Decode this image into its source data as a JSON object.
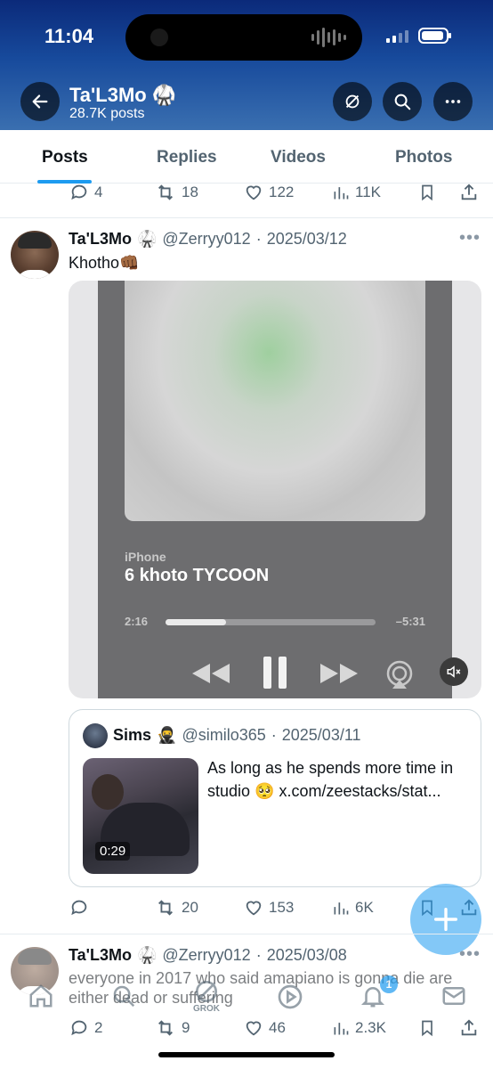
{
  "status_bar": {
    "time": "11:04"
  },
  "header": {
    "profile_name": "Ta'L3Mo 🥋",
    "post_count": "28.7K posts"
  },
  "tabs": [
    {
      "label": "Posts",
      "active": true
    },
    {
      "label": "Replies",
      "active": false
    },
    {
      "label": "Videos",
      "active": false
    },
    {
      "label": "Photos",
      "active": false
    }
  ],
  "prev_post_actions": {
    "replies": "4",
    "reposts": "18",
    "likes": "122",
    "views": "11K"
  },
  "post1": {
    "name": "Ta'L3Mo",
    "emoji": "🥋",
    "handle": "@Zerryy012",
    "date": "2025/03/12",
    "text": "Khotho👊🏾",
    "media": {
      "device": "iPhone",
      "track_title": "6 khoto TYCOON",
      "elapsed": "2:16",
      "remaining": "–5:31",
      "progress": 0.29
    },
    "quote": {
      "name": "Sims",
      "emoji": "🥷",
      "handle": "@similo365",
      "date": "2025/03/11",
      "text": "As long as he spends more time in studio 🥺 x.com/zeestacks/stat...",
      "video_duration": "0:29"
    },
    "actions": {
      "replies": "",
      "reposts": "20",
      "likes": "153",
      "views": "6K"
    }
  },
  "post2": {
    "name": "Ta'L3Mo",
    "emoji": "🥋",
    "handle": "@Zerryy012",
    "date": "2025/03/08",
    "text": "everyone in 2017 who said amapiano is gonna die  are either dead or suffering",
    "actions": {
      "replies": "2",
      "reposts": "9",
      "likes": "46",
      "views": "2.3K"
    }
  },
  "tabbar": {
    "grok_label": "GROK",
    "notification_count": "1"
  },
  "colors": {
    "accent": "#1d9bf0",
    "header_top": "#0b2a7a",
    "header_bottom": "#3a6fb0",
    "muted": "#536471"
  }
}
